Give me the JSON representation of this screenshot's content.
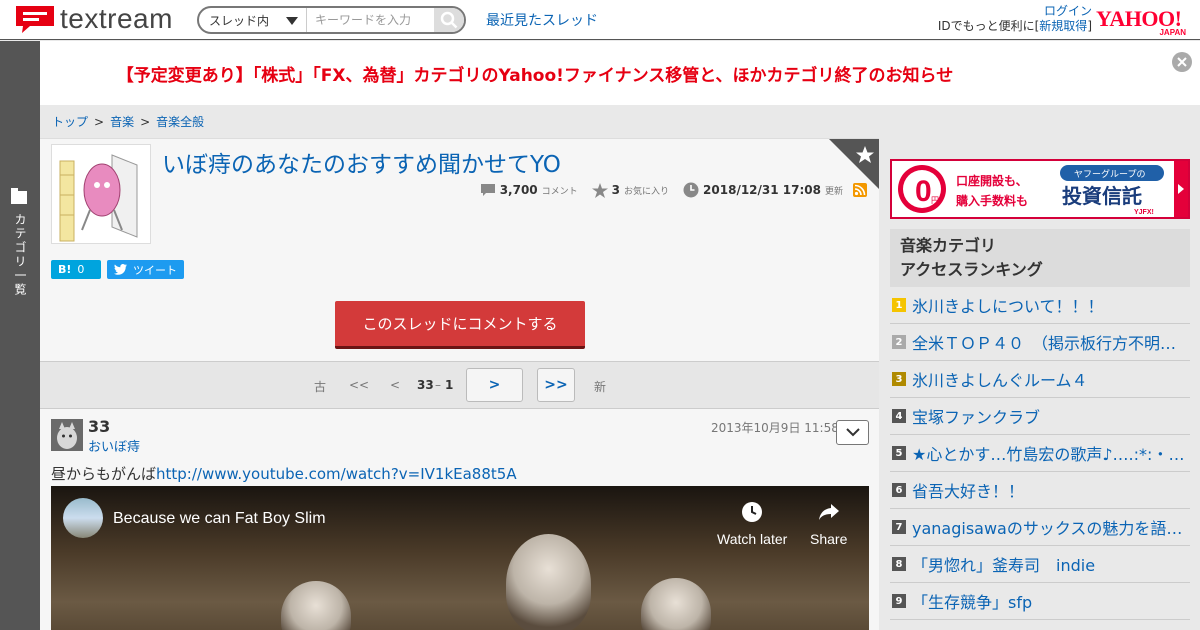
{
  "header": {
    "logo_text": "textream",
    "search_scope": "スレッド内",
    "search_placeholder": "キーワードを入力",
    "recent_link": "最近見たスレッド",
    "login_link": "ログイン",
    "id_prompt": "IDでもっと便利に[",
    "register_link": "新規取得",
    "id_prompt_close": "]",
    "yahoo_logo": "YAHOO!",
    "yahoo_sub": "JAPAN"
  },
  "rail": {
    "label": "カテゴリ一覧"
  },
  "notice": {
    "text": "【予定変更あり】「株式」「FX、為替」カテゴリのYahoo!ファイナンス移管と、ほかカテゴリ終了のお知らせ"
  },
  "breadcrumb": [
    "トップ",
    "音楽",
    "音楽全般"
  ],
  "breadcrumb_sep": ">",
  "thread": {
    "title": "いぼ痔のあなたのおすすめ聞かせてYO",
    "comment_count": "3,700",
    "comment_unit": "コメント",
    "fav_count": "3",
    "fav_unit": "お気に入り",
    "updated": "2018/12/31 17:08",
    "updated_unit": "更新",
    "hatena_label": "B!",
    "hatena_count": "0",
    "tweet_label": "ツイート",
    "comment_button": "このスレッドにコメントする"
  },
  "pager": {
    "oldest": "古",
    "first": "<<",
    "prev": "<",
    "current": "33",
    "dash": "–",
    "total": "1",
    "next": ">",
    "last": ">>",
    "newest": "新"
  },
  "post": {
    "number": "33",
    "author": "おいぼ痔",
    "date": "2013年10月9日 11:58",
    "body_text": "昼からもがんば",
    "body_link": "http://www.youtube.com/watch?v=IV1kEa88t5A",
    "video_title": "Because we can Fat Boy Slim",
    "watch_later": "Watch later",
    "share": "Share"
  },
  "ad": {
    "zero": "0",
    "yen": "円",
    "line1": "口座開設も、",
    "line2": "購入手数料も",
    "tag": "ヤフーグループの",
    "product": "投資信託",
    "brand": "YJFX!"
  },
  "ranking": {
    "title_line1": "音楽カテゴリ",
    "title_line2": "アクセスランキング",
    "items": [
      {
        "rank": "1",
        "label": "氷川きよしについて！！！",
        "color": "#f5c400"
      },
      {
        "rank": "2",
        "label": "全米ＴＯＰ４０　（掲示板行方不明…",
        "color": "#aaaaaa"
      },
      {
        "rank": "3",
        "label": "氷川きよしんぐルーム４",
        "color": "#b08a00"
      },
      {
        "rank": "4",
        "label": "宝塚ファンクラブ",
        "color": "#555555"
      },
      {
        "rank": "5",
        "label": "★心とかす…竹島宏の歌声♪….:*:・°☆",
        "color": "#555555"
      },
      {
        "rank": "6",
        "label": "省吾大好き！！",
        "color": "#555555"
      },
      {
        "rank": "7",
        "label": "yanagisawaのサックスの魅力を語ろ…",
        "color": "#555555"
      },
      {
        "rank": "8",
        "label": "「男惚れ」釜寿司　indie",
        "color": "#555555"
      },
      {
        "rank": "9",
        "label": "「生存競争」sfp",
        "color": "#555555"
      }
    ]
  }
}
